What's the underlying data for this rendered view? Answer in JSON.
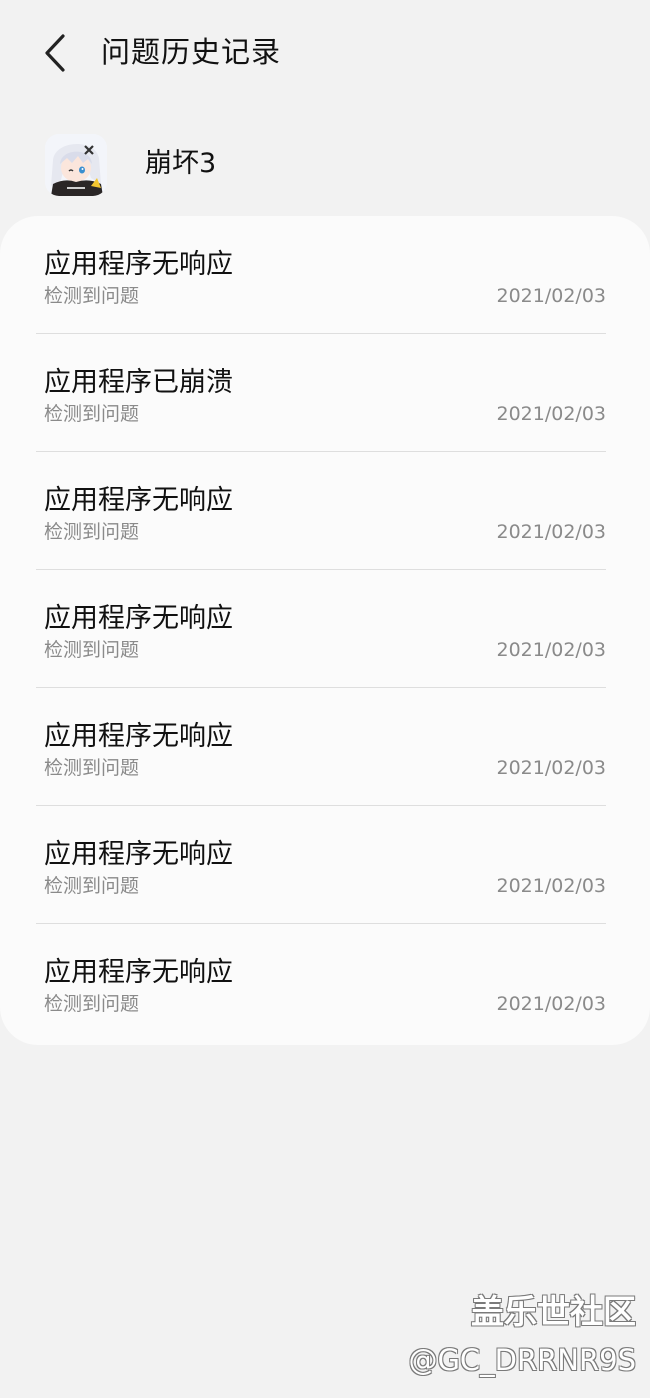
{
  "header": {
    "back_icon": "chevron-left-icon",
    "title": "问题历史记录"
  },
  "app": {
    "icon": "app-avatar-icon",
    "name": "崩坏3"
  },
  "list": {
    "items": [
      {
        "title": "应用程序无响应",
        "subtitle": "检测到问题",
        "date": "2021/02/03"
      },
      {
        "title": "应用程序已崩溃",
        "subtitle": "检测到问题",
        "date": "2021/02/03"
      },
      {
        "title": "应用程序无响应",
        "subtitle": "检测到问题",
        "date": "2021/02/03"
      },
      {
        "title": "应用程序无响应",
        "subtitle": "检测到问题",
        "date": "2021/02/03"
      },
      {
        "title": "应用程序无响应",
        "subtitle": "检测到问题",
        "date": "2021/02/03"
      },
      {
        "title": "应用程序无响应",
        "subtitle": "检测到问题",
        "date": "2021/02/03"
      },
      {
        "title": "应用程序无响应",
        "subtitle": "检测到问题",
        "date": "2021/02/03"
      }
    ]
  },
  "watermark": {
    "line1": "盖乐世社区",
    "line2": "@GC_DRRNR9S"
  },
  "colors": {
    "background": "#f2f2f2",
    "card": "#fbfbfb",
    "primary_text": "#111111",
    "secondary_text": "#8a8a8a",
    "divider": "#dedede"
  }
}
